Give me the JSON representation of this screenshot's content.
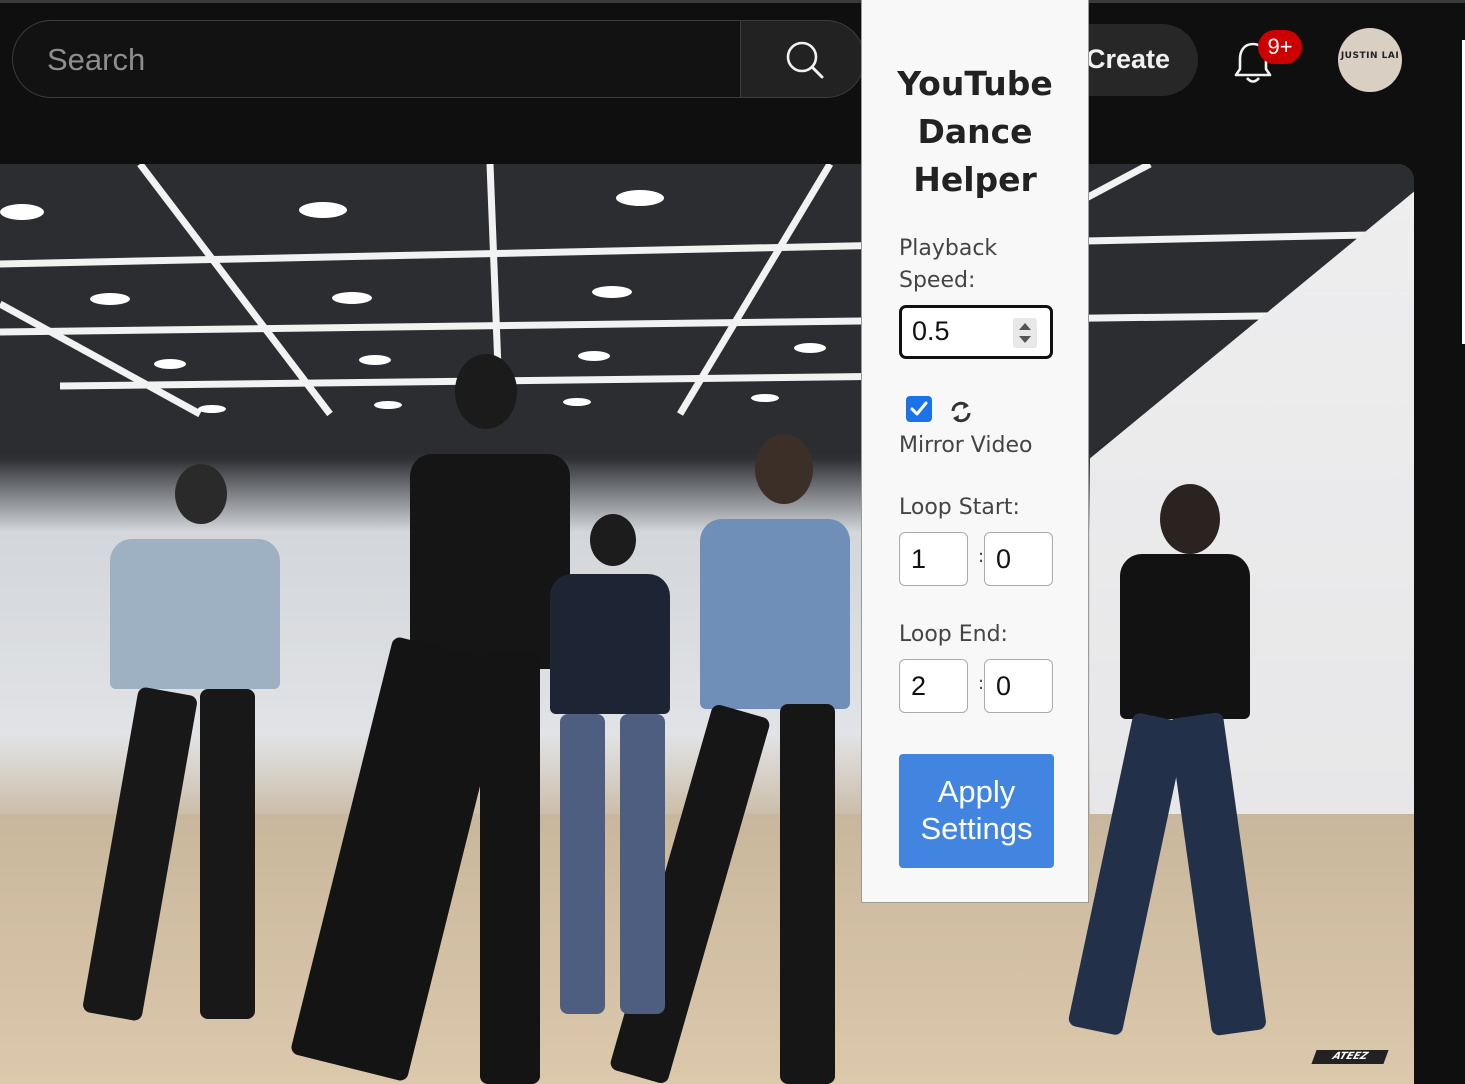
{
  "header": {
    "search": {
      "placeholder": "Search",
      "value": ""
    },
    "create_label": "Create",
    "notification_badge": "9+",
    "avatar_text": "JUSTIN LAI"
  },
  "video": {
    "watermark": "ATEEZ"
  },
  "extension": {
    "title": "YouTube Dance Helper",
    "playback_speed_label": "Playback Speed:",
    "playback_speed_value": "0.5",
    "mirror_checked": true,
    "mirror_label": "Mirror Video",
    "loop_start_label": "Loop Start:",
    "loop_start_min": "1",
    "loop_start_sec": "0",
    "loop_end_label": "Loop End:",
    "loop_end_min": "2",
    "loop_end_sec": "0",
    "time_separator": ":",
    "apply_label": "Apply Settings"
  },
  "colors": {
    "background": "#0f0f0f",
    "accent": "#4285e0",
    "checkbox": "#1a73e8",
    "badge": "#cc0000"
  },
  "icons": [
    "search-icon",
    "bell-icon",
    "sync-icon",
    "checkmark-icon",
    "spinner-arrows-icon"
  ]
}
